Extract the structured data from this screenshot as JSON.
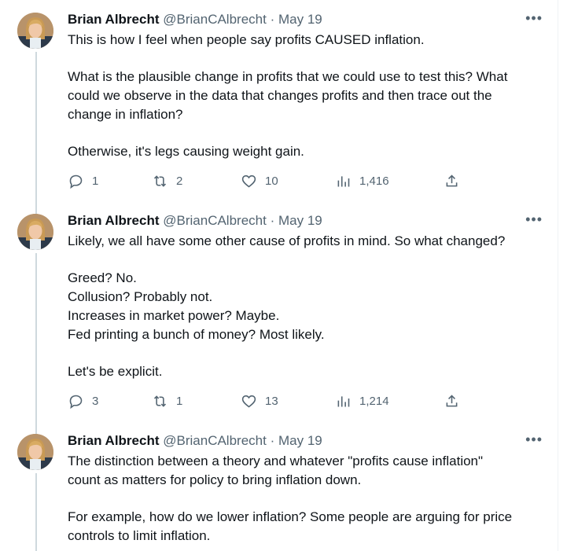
{
  "tweets": [
    {
      "author": "Brian Albrecht",
      "handle": "@BrianCAlbrecht",
      "separator": "·",
      "date": "May 19",
      "paragraphs": [
        [
          "This is how I feel when people say profits CAUSED inflation."
        ],
        [
          "What is the plausible change in profits that we could use to test this? What",
          "could we observe in the data that changes profits and then trace out the",
          "change in inflation?"
        ],
        [
          "Otherwise, it's legs causing weight gain."
        ]
      ],
      "replies": "1",
      "retweets": "2",
      "likes": "10",
      "views": "1,416"
    },
    {
      "author": "Brian Albrecht",
      "handle": "@BrianCAlbrecht",
      "separator": "·",
      "date": "May 19",
      "paragraphs": [
        [
          "Likely, we all have some other cause of profits in mind. So what changed?"
        ],
        [
          "Greed? No.",
          "Collusion? Probably not.",
          "Increases in market power? Maybe.",
          "Fed printing a bunch of money? Most likely."
        ],
        [
          "Let's be explicit."
        ]
      ],
      "replies": "3",
      "retweets": "1",
      "likes": "13",
      "views": "1,214"
    },
    {
      "author": "Brian Albrecht",
      "handle": "@BrianCAlbrecht",
      "separator": "·",
      "date": "May 19",
      "paragraphs": [
        [
          "The distinction between a theory and whatever \"profits cause inflation\"",
          "count as matters for policy to bring inflation down."
        ],
        [
          "For example, how do we lower inflation? Some people are arguing for price",
          "controls to limit inflation."
        ]
      ]
    }
  ],
  "more_icon": "more-horizontal-icon",
  "colors": {
    "text": "#0f1419",
    "secondary": "#536471",
    "thread_line": "#cfd9de"
  }
}
